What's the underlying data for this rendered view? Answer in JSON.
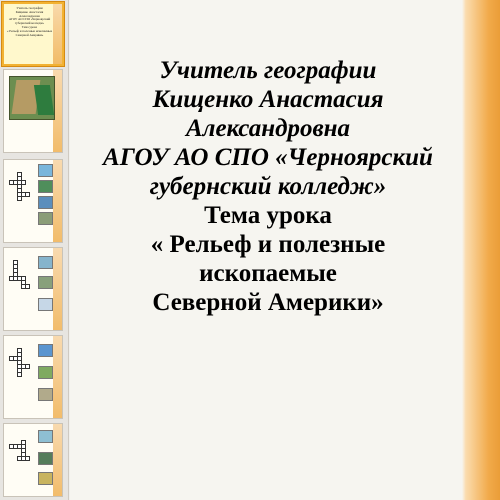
{
  "sidebar": {
    "slides": [
      {
        "lines": [
          "Учитель географии",
          "Кищенко Анастасия Александровна",
          "АГОУ АО СПО «Черноярский",
          "губернский колледж»",
          "Тема урока",
          "« Рельеф и полезные ископаемые",
          "Северной Америки»"
        ]
      }
    ]
  },
  "slide": {
    "lines": [
      "Учитель географии",
      "Кищенко Анастасия Александровна",
      "АГОУ АО СПО «Черноярский",
      "губернский колледж»",
      "Тема урока",
      "« Рельеф  и полезные ископаемые",
      "Северной Америки»"
    ]
  },
  "colors": {
    "sidebar_background": "#e7e5e1",
    "slide_background": "#f6f5f0",
    "accent_orange": "#f1aa4a",
    "selected_outline": "#f2b233"
  }
}
